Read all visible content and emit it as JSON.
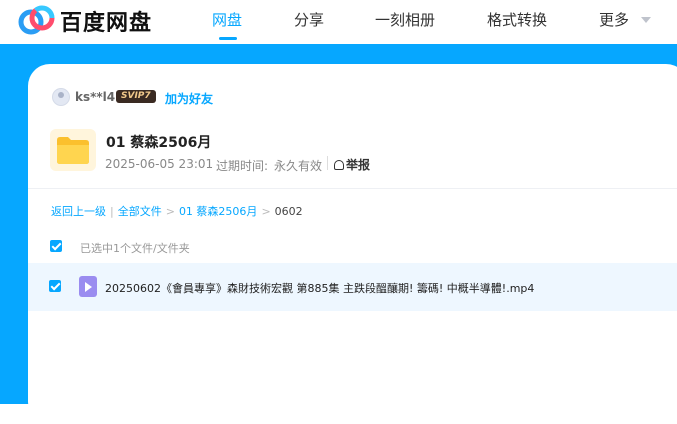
{
  "header": {
    "brand": "百度网盘",
    "nav": [
      {
        "label": "网盘",
        "active": true
      },
      {
        "label": "分享",
        "active": false
      },
      {
        "label": "一刻相册",
        "active": false
      },
      {
        "label": "格式转换",
        "active": false
      },
      {
        "label": "更多",
        "active": false
      }
    ]
  },
  "sharer": {
    "name": "ks**l4",
    "vip_badge": "SVIP7",
    "add_friend": "加为好友"
  },
  "share": {
    "folder_title": "01 蔡森2506月",
    "date": "2025-06-05 23:01",
    "expire_label": "过期时间:",
    "expire_value": "永久有效",
    "report": "举报"
  },
  "breadcrumb": {
    "back": "返回上一级",
    "all_files": "全部文件",
    "folder": "01 蔡森2506月",
    "current": "0602"
  },
  "selection": {
    "summary": "已选中1个文件/文件夹"
  },
  "files": [
    {
      "name": "20250602《會員專享》森財技術宏觀 第885集 主跌段醞釀期! 籌碼! 中概半導體!.mp4",
      "checked": true
    }
  ],
  "colors": {
    "accent": "#06a7ff",
    "folder": "#fbc02d",
    "video_icon": "#9a8cf0"
  }
}
